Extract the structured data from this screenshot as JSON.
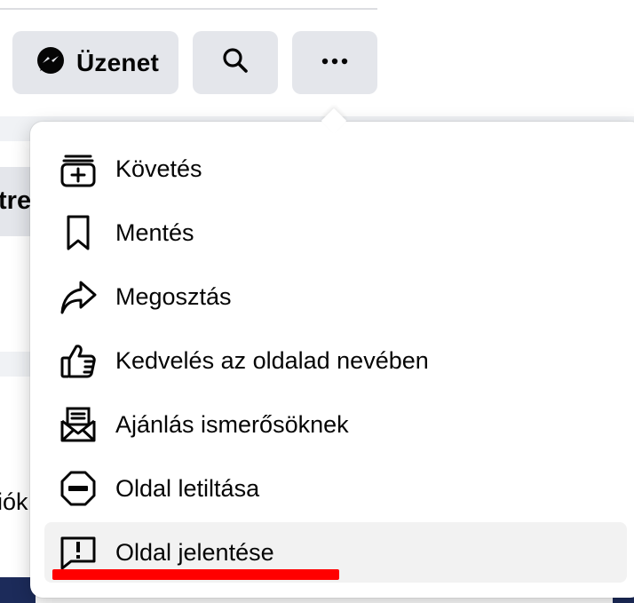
{
  "toolbar": {
    "message_label": "Üzenet",
    "icons": [
      "messenger-icon",
      "search-icon",
      "more-dots-icon"
    ]
  },
  "background": {
    "left_tab_fragment": "tre",
    "left_text_fragment": "iók"
  },
  "menu": {
    "items": [
      {
        "label": "Követés",
        "icon": "follow-icon"
      },
      {
        "label": "Mentés",
        "icon": "bookmark-icon"
      },
      {
        "label": "Megosztás",
        "icon": "share-icon"
      },
      {
        "label": "Kedvelés az oldalad nevében",
        "icon": "like-icon"
      },
      {
        "label": "Ajánlás ismerősöknek",
        "icon": "invite-icon"
      },
      {
        "label": "Oldal letiltása",
        "icon": "block-icon"
      },
      {
        "label": "Oldal jelentése",
        "icon": "report-icon"
      }
    ],
    "highlighted_item": "Oldal jelentése",
    "annotation_color": "#ff0000"
  }
}
